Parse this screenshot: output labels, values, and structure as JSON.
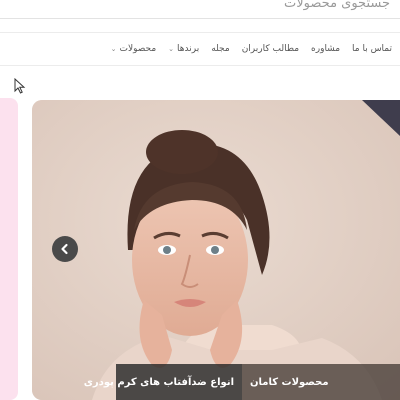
{
  "search": {
    "placeholder": "جستجوی محصولات"
  },
  "nav": {
    "items": [
      {
        "label": "محصولات",
        "caret": "⌄"
      },
      {
        "label": "برندها",
        "caret": "⌄"
      },
      {
        "label": "مجله",
        "caret": ""
      },
      {
        "label": "مطالب کاربران",
        "caret": ""
      },
      {
        "label": "مشاوره",
        "caret": ""
      },
      {
        "label": "تماس با ما",
        "caret": ""
      }
    ]
  },
  "slider": {
    "prev_icon": "chevron-left-icon",
    "captions": [
      {
        "label": "محصولات کامان"
      },
      {
        "label": "انواع ضدآفتاب های کرم پودری"
      }
    ]
  },
  "colors": {
    "side_slide": "#fce1ee",
    "slide_bg": "#e7d6cc",
    "caption_dark": "#282828"
  }
}
